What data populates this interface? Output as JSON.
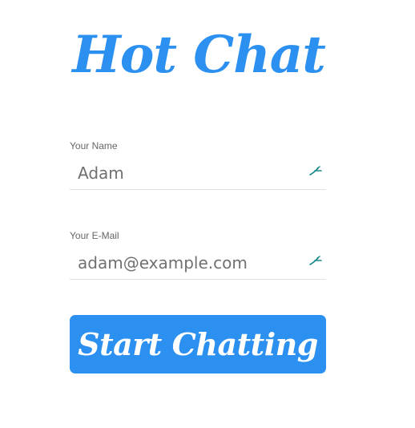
{
  "app": {
    "logo_text": "Hot Chat"
  },
  "form": {
    "name_label": "Your Name",
    "name_value": "Adam",
    "email_label": "Your E-Mail",
    "email_value": "adam@example.com",
    "submit_label": "Start Chatting"
  },
  "colors": {
    "brand": "#2b90f0",
    "label": "#666666",
    "input_text": "#707070",
    "underline": "#e1e1e1",
    "autofill_icon": "#1a8a8a"
  },
  "icons": {
    "autofill": "autofill-key-icon"
  }
}
